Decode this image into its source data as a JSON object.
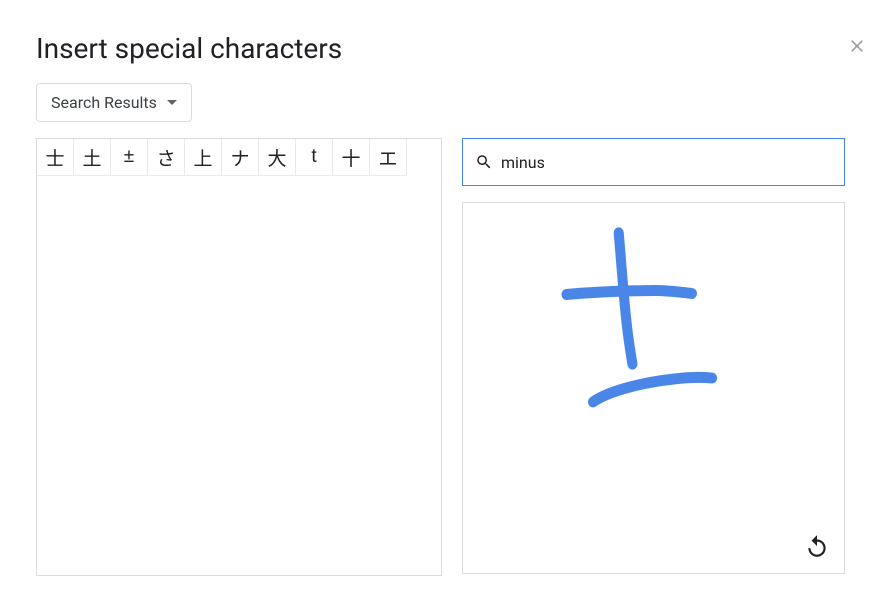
{
  "dialog": {
    "title": "Insert special characters"
  },
  "dropdown": {
    "label": "Search Results"
  },
  "results": {
    "chars": [
      "士",
      "土",
      "±",
      "さ",
      "上",
      "ナ",
      "大",
      "t",
      "十",
      "エ"
    ]
  },
  "search": {
    "value": "minus",
    "placeholder": ""
  },
  "icons": {
    "close": "close-icon",
    "search": "search-icon",
    "undo": "undo-icon",
    "dropdown": "chevron-down-icon"
  }
}
